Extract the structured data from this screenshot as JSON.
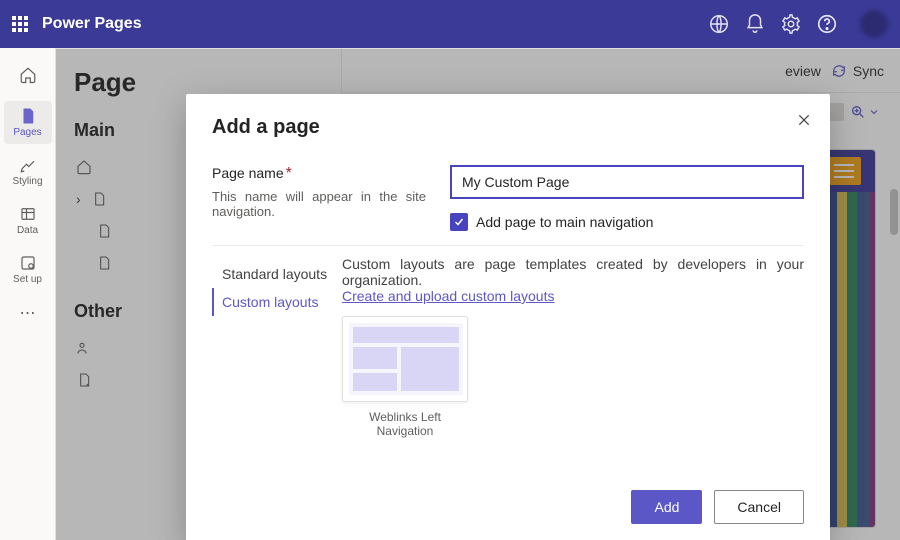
{
  "brand": "Power Pages",
  "header_actions": {
    "preview": "eview",
    "sync": "Sync"
  },
  "rail": {
    "pages": "Pages",
    "styling": "Styling",
    "data": "Data",
    "setup": "Set up"
  },
  "pages_panel": {
    "title": "Page",
    "main_section": "Main ",
    "other_section": "Other"
  },
  "modal": {
    "title": "Add a page",
    "page_name_label": "Page name",
    "page_name_help": "This name will appear in the site navigation.",
    "page_name_value": "My Custom Page",
    "add_to_nav": "Add page to main navigation",
    "tabs": {
      "standard": "Standard layouts",
      "custom": "Custom layouts"
    },
    "custom_desc": "Custom layouts are page templates created by developers in your organization.",
    "custom_link": "Create and upload custom layouts",
    "card_label": "Weblinks Left Navigation",
    "add_btn": "Add",
    "cancel_btn": "Cancel"
  }
}
